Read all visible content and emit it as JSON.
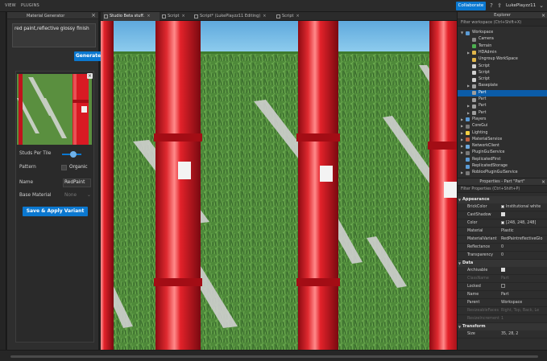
{
  "menu": {
    "items": [
      "VIEW",
      "PLUGINS"
    ],
    "collaborate_label": "Collaborate",
    "username": "LukePlayzz11"
  },
  "material_generator": {
    "title": "Material Generator",
    "prompt_value": "red paint,reflective glossy finish",
    "generate_label": "Generate",
    "variant": {
      "studs_per_tile_label": "Studs Per Tile",
      "studs_per_tile_level": 0.6,
      "pattern_label": "Pattern",
      "pattern_value": "Organic",
      "name_label": "Name",
      "name_value": "RedPaint",
      "base_material_label": "Base Material",
      "base_material_value": "None",
      "save_label": "Save & Apply Variant"
    }
  },
  "tabs": [
    {
      "label": "Studio Beta stuff.",
      "active": true
    },
    {
      "label": "Script",
      "active": false
    },
    {
      "label": "Script* (LukePlayzz11 Editing)",
      "active": false
    },
    {
      "label": "Script",
      "active": false
    }
  ],
  "explorer": {
    "title": "Explorer",
    "filter_placeholder": "Filter workspace (Ctrl+Shift+X)",
    "items": [
      {
        "label": "Workspace",
        "depth": 0,
        "arrow": "down",
        "icon": "workspace-icon",
        "color": "#5a9bd5"
      },
      {
        "label": "Camera",
        "depth": 1,
        "arrow": "",
        "icon": "camera-icon",
        "color": "#8a8a8a"
      },
      {
        "label": "Terrain",
        "depth": 1,
        "arrow": "",
        "icon": "terrain-icon",
        "color": "#4caf50"
      },
      {
        "label": "HDAdmin",
        "depth": 1,
        "arrow": "right",
        "icon": "folder-icon",
        "color": "#e0b64a"
      },
      {
        "label": "Ungroup WorkSpace",
        "depth": 1,
        "arrow": "",
        "icon": "folder-icon",
        "color": "#e0b64a"
      },
      {
        "label": "Script",
        "depth": 1,
        "arrow": "",
        "icon": "script-icon",
        "color": "#d0d0d0"
      },
      {
        "label": "Script",
        "depth": 1,
        "arrow": "",
        "icon": "script-icon",
        "color": "#d0d0d0"
      },
      {
        "label": "Script",
        "depth": 1,
        "arrow": "",
        "icon": "script-icon",
        "color": "#d0d0d0"
      },
      {
        "label": "Baseplate",
        "depth": 1,
        "arrow": "right",
        "icon": "part-icon",
        "color": "#9e9e9e"
      },
      {
        "label": "Part",
        "depth": 1,
        "arrow": "",
        "icon": "part-icon",
        "color": "#9e9e9e",
        "selected": true
      },
      {
        "label": "Part",
        "depth": 1,
        "arrow": "",
        "icon": "part-icon",
        "color": "#9e9e9e"
      },
      {
        "label": "Part",
        "depth": 1,
        "arrow": "right",
        "icon": "part-icon",
        "color": "#9e9e9e"
      },
      {
        "label": "Part",
        "depth": 1,
        "arrow": "right",
        "icon": "part-icon",
        "color": "#9e9e9e"
      },
      {
        "label": "Players",
        "depth": 0,
        "arrow": "right",
        "icon": "players-icon",
        "color": "#5a9bd5"
      },
      {
        "label": "CoreGui",
        "depth": 0,
        "arrow": "right",
        "icon": "gui-icon",
        "color": "#7a7a7a"
      },
      {
        "label": "Lighting",
        "depth": 0,
        "arrow": "right",
        "icon": "lighting-icon",
        "color": "#f5d142"
      },
      {
        "label": "MaterialService",
        "depth": 0,
        "arrow": "right",
        "icon": "material-icon",
        "color": "#c06040"
      },
      {
        "label": "NetworkClient",
        "depth": 0,
        "arrow": "right",
        "icon": "network-icon",
        "color": "#6fa8dc"
      },
      {
        "label": "PluginGuiService",
        "depth": 0,
        "arrow": "right",
        "icon": "gui-icon",
        "color": "#7a7a7a"
      },
      {
        "label": "ReplicatedFirst",
        "depth": 0,
        "arrow": "",
        "icon": "replicated-icon",
        "color": "#5a9bd5"
      },
      {
        "label": "ReplicatedStorage",
        "depth": 0,
        "arrow": "",
        "icon": "replicated-icon",
        "color": "#5a9bd5"
      },
      {
        "label": "RobloxPluginGuiService",
        "depth": 0,
        "arrow": "right",
        "icon": "gui-icon",
        "color": "#7a7a7a"
      }
    ]
  },
  "properties": {
    "title": "Properties - Part \"Part\"",
    "filter_placeholder": "Filter Properties (Ctrl+Shift+P)",
    "sections": [
      {
        "label": "Appearance",
        "top_row": 0
      },
      {
        "label": "Data",
        "top_row": 10
      },
      {
        "label": "Transform",
        "top_row": 20
      }
    ],
    "rows": [
      {
        "name": "BrickColor",
        "value": "Institutional white",
        "kind": "swatch",
        "swatch": "#f5f5f5",
        "dim": false
      },
      {
        "name": "CastShadow",
        "value": "",
        "kind": "check",
        "checked": true,
        "dim": false
      },
      {
        "name": "Color",
        "value": "[248, 248, 248]",
        "kind": "swatch",
        "swatch": "#f8f8f8",
        "dim": false
      },
      {
        "name": "Material",
        "value": "Plastic",
        "kind": "text",
        "dim": false
      },
      {
        "name": "MaterialVariant",
        "value": "RedPaintreflectiveGlo",
        "kind": "text",
        "dim": false
      },
      {
        "name": "Reflectance",
        "value": "0",
        "kind": "text",
        "dim": false
      },
      {
        "name": "Transparency",
        "value": "0",
        "kind": "text",
        "dim": false
      },
      {
        "name": "Archivable",
        "value": "",
        "kind": "check",
        "checked": true,
        "dim": false
      },
      {
        "name": "ClassName",
        "value": "Part",
        "kind": "text",
        "dim": true
      },
      {
        "name": "Locked",
        "value": "",
        "kind": "check",
        "checked": false,
        "dim": false
      },
      {
        "name": "Name",
        "value": "Part",
        "kind": "text",
        "dim": false
      },
      {
        "name": "Parent",
        "value": "Workspace",
        "kind": "text",
        "dim": false
      },
      {
        "name": "ResizeableFaces",
        "value": "Right, Top, Back, Le",
        "kind": "text",
        "dim": true
      },
      {
        "name": "ResizeIncrement",
        "value": "1",
        "kind": "text",
        "dim": true
      },
      {
        "name": "Size",
        "value": "35, 28, 2",
        "kind": "text",
        "dim": false
      }
    ]
  },
  "colors": {
    "accent": "#0b78d0",
    "grass": "#4f8a3a",
    "sky": "#7cc0e8",
    "paint_red": "#d81a23"
  }
}
